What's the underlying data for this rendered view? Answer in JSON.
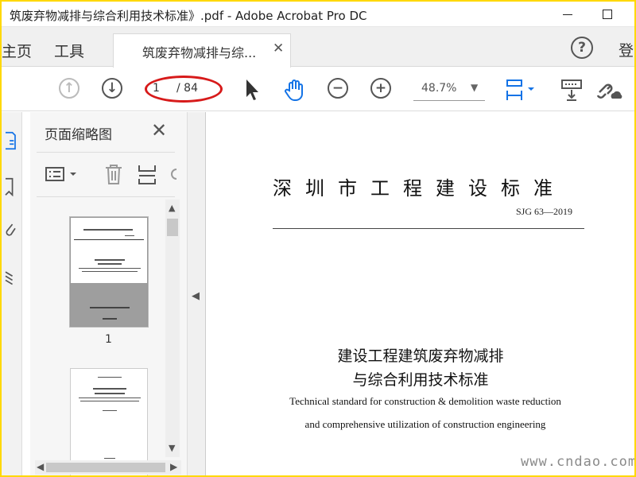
{
  "window": {
    "title": "筑废弃物减排与综合利用技术标准》.pdf - Adobe Acrobat Pro DC"
  },
  "tabs": {
    "home_label": "主页",
    "tools_label": "工具",
    "document_tab_label": "筑废弃物减排与综...",
    "signin_label": "登"
  },
  "toolbar": {
    "current_page": "1",
    "total_pages": "/ 84",
    "zoom_value": "48.7%"
  },
  "thumbnails_panel": {
    "title": "页面缩略图",
    "page_numbers": [
      "1"
    ]
  },
  "document": {
    "standard_title": "深圳市工程建设标准",
    "code": "SJG 63—2019",
    "cn_title_line1": "建设工程建筑废弃物减排",
    "cn_title_line2": "与综合利用技术标准",
    "en_title_line1": "Technical standard for construction & demolition waste reduction",
    "en_title_line2": "and comprehensive utilization of construction engineering"
  },
  "watermark_text": "www.cndao.com",
  "colors": {
    "frame": "#ffd800",
    "annotation": "#d71a1a",
    "accent_blue": "#1473e6"
  }
}
